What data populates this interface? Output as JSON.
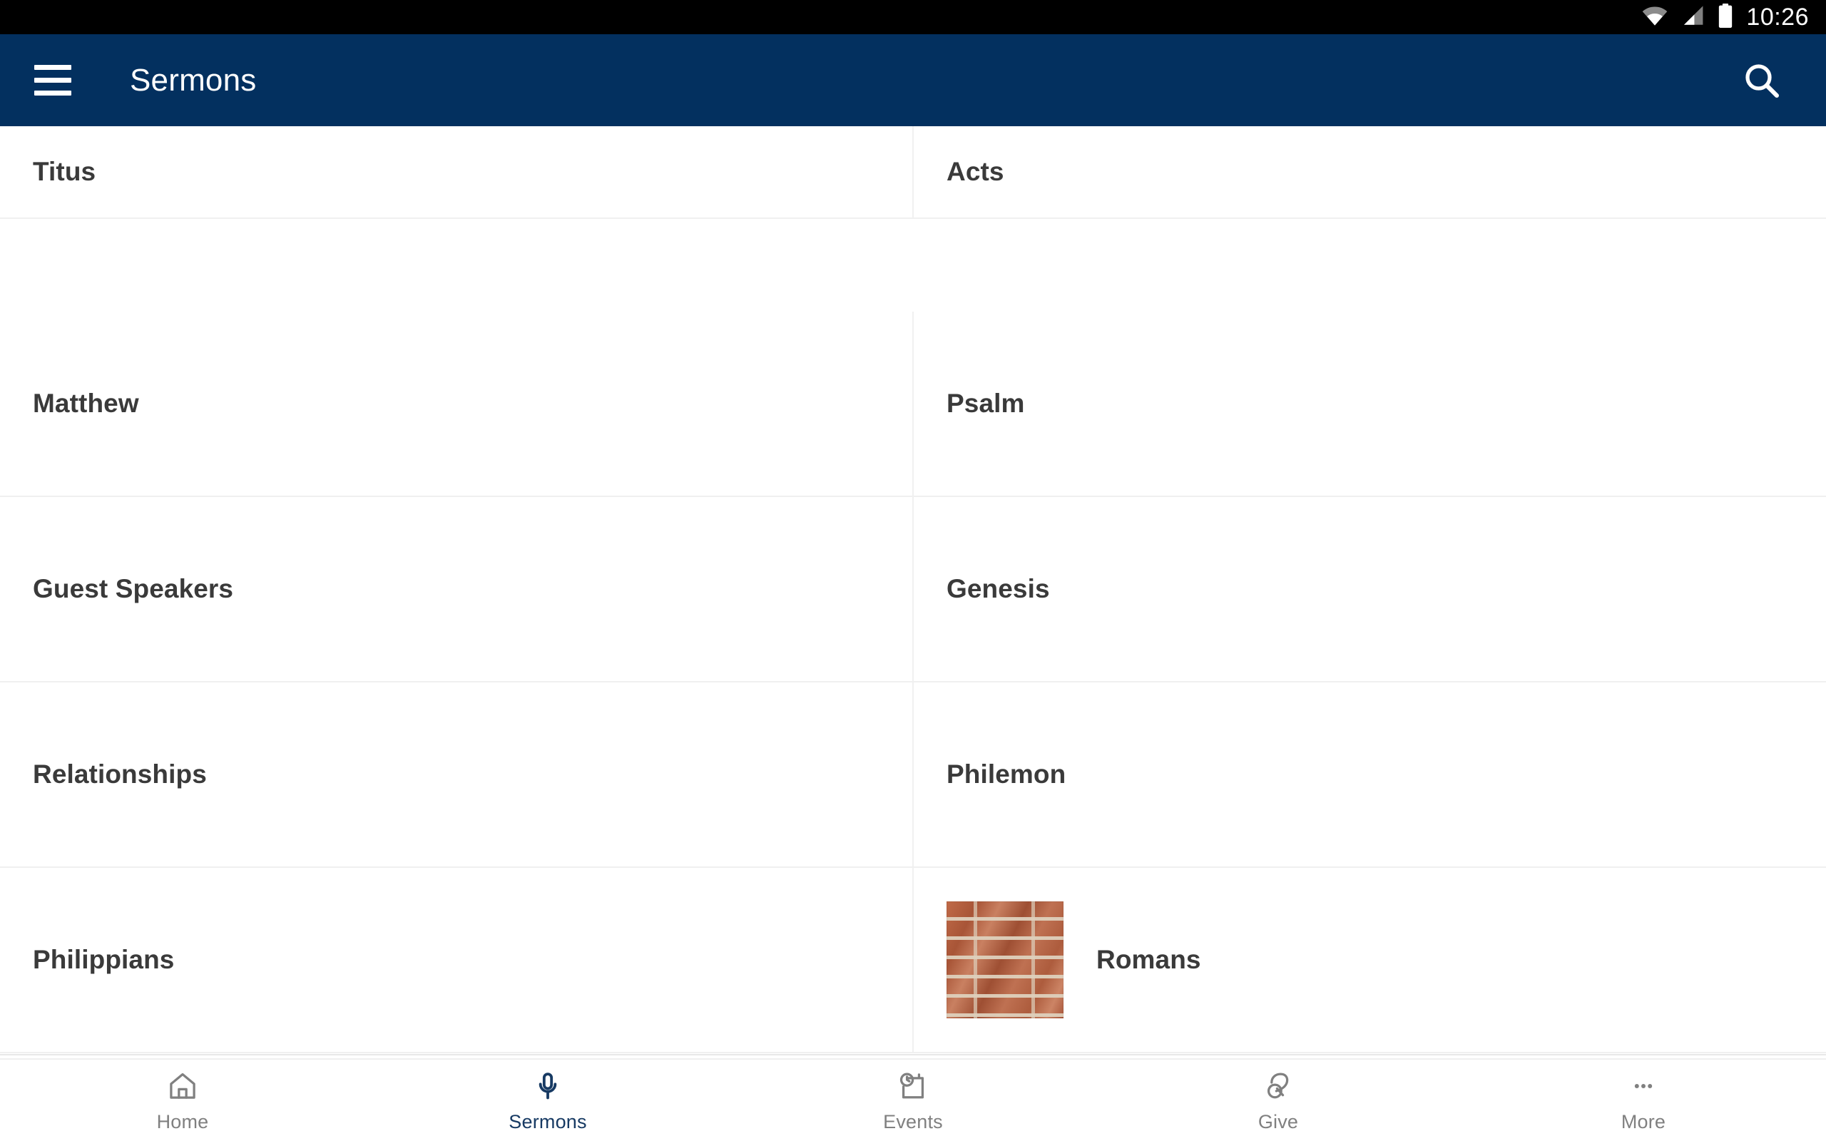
{
  "status_bar": {
    "time": "10:26",
    "icons": [
      "wifi-icon",
      "cellular-signal-icon",
      "battery-icon"
    ]
  },
  "app_bar": {
    "title": "Sermons",
    "menu_icon": "hamburger-menu-icon",
    "search_icon": "search-icon",
    "background_color": "#03305f",
    "text_color": "#ffffff"
  },
  "content": {
    "columns": 2,
    "items": [
      {
        "label": "Titus",
        "column": "left",
        "thumbnail": null,
        "partial_top": true
      },
      {
        "label": "Acts",
        "column": "right",
        "thumbnail": null,
        "partial_top": true
      },
      {
        "label": "Matthew",
        "column": "left",
        "thumbnail": null
      },
      {
        "label": "Psalm",
        "column": "right",
        "thumbnail": null
      },
      {
        "label": "Guest Speakers",
        "column": "left",
        "thumbnail": null
      },
      {
        "label": "Genesis",
        "column": "right",
        "thumbnail": null
      },
      {
        "label": "Relationships",
        "column": "left",
        "thumbnail": null
      },
      {
        "label": "Philemon",
        "column": "right",
        "thumbnail": null
      },
      {
        "label": "Philippians",
        "column": "left",
        "thumbnail": null
      },
      {
        "label": "Romans",
        "column": "right",
        "thumbnail": "brick-wall-thumbnail"
      }
    ]
  },
  "bottom_nav": {
    "active_index": 1,
    "active_color": "#173a63",
    "inactive_color": "#808080",
    "items": [
      {
        "label": "Home",
        "icon": "home-icon"
      },
      {
        "label": "Sermons",
        "icon": "microphone-icon"
      },
      {
        "label": "Events",
        "icon": "events-calendar-clock-icon"
      },
      {
        "label": "Give",
        "icon": "giving-hand-icon"
      },
      {
        "label": "More",
        "icon": "more-dots-icon"
      }
    ]
  }
}
